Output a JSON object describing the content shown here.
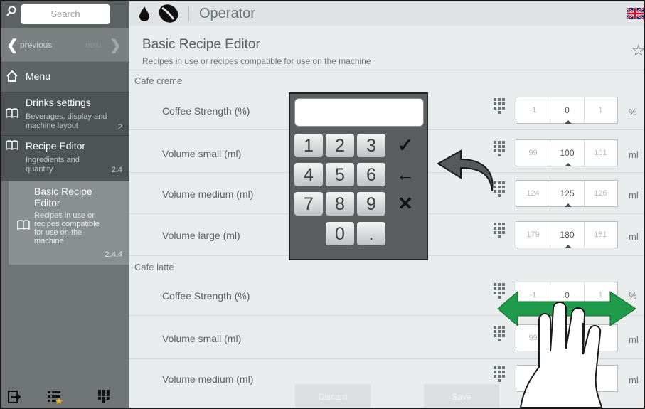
{
  "sidebar": {
    "search_placeholder": "Search",
    "previous": "previous",
    "next": "next",
    "menu": "Menu",
    "items": [
      {
        "title": "Drinks settings",
        "subtitle": "Beverages, display and machine layout",
        "number": "2"
      },
      {
        "title": "Recipe Editor",
        "subtitle": "Ingredients and quantity",
        "number": "2.4"
      }
    ],
    "active": {
      "title": "Basic Recipe Editor",
      "subtitle": "Recipes in use or recipes compatible for use on the machine",
      "number": "2.4.4"
    }
  },
  "topbar": {
    "title": "Operator"
  },
  "page": {
    "title": "Basic Recipe Editor",
    "subtitle": "Recipes in use or recipes compatible for use on the machine"
  },
  "sections": [
    {
      "name": "Cafe creme",
      "rows": [
        {
          "label": "Coffee Strength (%)",
          "minus": "-1",
          "value": "0",
          "plus": "1",
          "unit": "%"
        },
        {
          "label": "Volume small (ml)",
          "minus": "99",
          "value": "100",
          "plus": "101",
          "unit": "ml"
        },
        {
          "label": "Volume medium (ml)",
          "minus": "124",
          "value": "125",
          "plus": "126",
          "unit": "ml"
        },
        {
          "label": "Volume large (ml)",
          "minus": "179",
          "value": "180",
          "plus": "181",
          "unit": "ml"
        }
      ]
    },
    {
      "name": "Cafe latte",
      "rows": [
        {
          "label": "Coffee Strength (%)",
          "minus": "-1",
          "value": "0",
          "plus": "1",
          "unit": "%"
        },
        {
          "label": "Volume small (ml)",
          "minus": "99",
          "value": "",
          "plus": "",
          "unit": "ml"
        },
        {
          "label": "Volume medium (ml)",
          "minus": "1",
          "value": "",
          "plus": "",
          "unit": "ml"
        }
      ]
    }
  ],
  "keypad": {
    "keys": [
      "1",
      "2",
      "3",
      "4",
      "5",
      "6",
      "7",
      "8",
      "9",
      "0",
      "."
    ],
    "confirm": "✓",
    "backspace": "←",
    "cancel": "✕"
  },
  "footer": {
    "discard": "Discard",
    "save": "Save"
  },
  "colors": {
    "sidebar": "#6f7475",
    "content": "#e9ecec",
    "gesture_arrow": "#1f9a4a"
  }
}
